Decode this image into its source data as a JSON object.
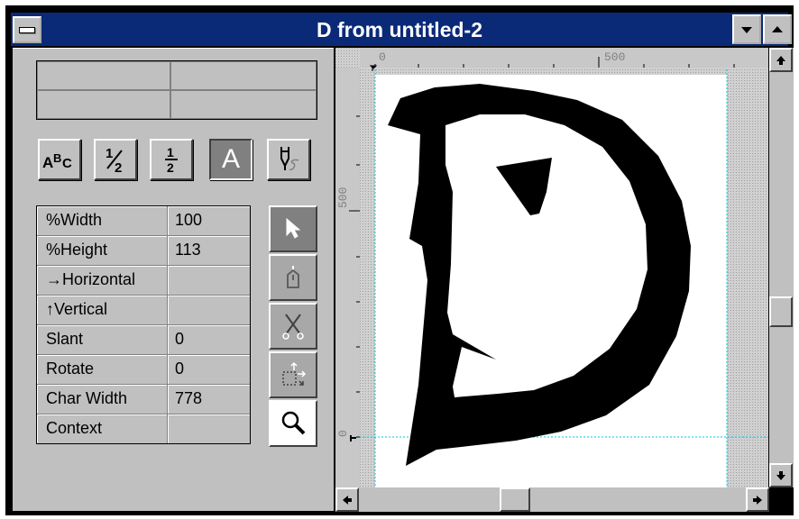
{
  "window": {
    "title": "D from untitled-2",
    "sys_icon": "system-menu-icon",
    "minimize_icon": "down-arrow-icon",
    "maximize_icon": "up-arrow-icon"
  },
  "toolbar": {
    "buttons": [
      {
        "name": "abc-button",
        "label": "ABC"
      },
      {
        "name": "half-fraction-button",
        "label": "½"
      },
      {
        "name": "stacked-fraction-button",
        "label": "1/2"
      },
      {
        "name": "letter-a-button",
        "label": "A",
        "active": true
      },
      {
        "name": "pen-tool-button",
        "label": "pen-icon"
      }
    ]
  },
  "properties": [
    {
      "label": "%Width",
      "value": "100"
    },
    {
      "label": "%Height",
      "value": "113"
    },
    {
      "label": "→Horizontal",
      "value": ""
    },
    {
      "label": "↑Vertical",
      "value": ""
    },
    {
      "label": "Slant",
      "value": "0"
    },
    {
      "label": "Rotate",
      "value": "0"
    },
    {
      "label": "Char Width",
      "value": "778"
    },
    {
      "label": "Context",
      "value": ""
    }
  ],
  "tools": [
    {
      "name": "pointer-tool",
      "icon": "arrow-pointer-icon"
    },
    {
      "name": "add-point-tool",
      "icon": "pen-nib-icon"
    },
    {
      "name": "cut-tool",
      "icon": "scissors-icon"
    },
    {
      "name": "transform-tool",
      "icon": "transform-icon"
    },
    {
      "name": "zoom-tool",
      "icon": "magnifier-icon"
    }
  ],
  "ruler": {
    "h_labels": [
      "0",
      "500"
    ],
    "v_labels": [
      "500",
      "0"
    ]
  },
  "glyph": {
    "character": "D"
  },
  "colors": {
    "titlebar": "#0a2a78",
    "guide": "#00c8d8"
  }
}
